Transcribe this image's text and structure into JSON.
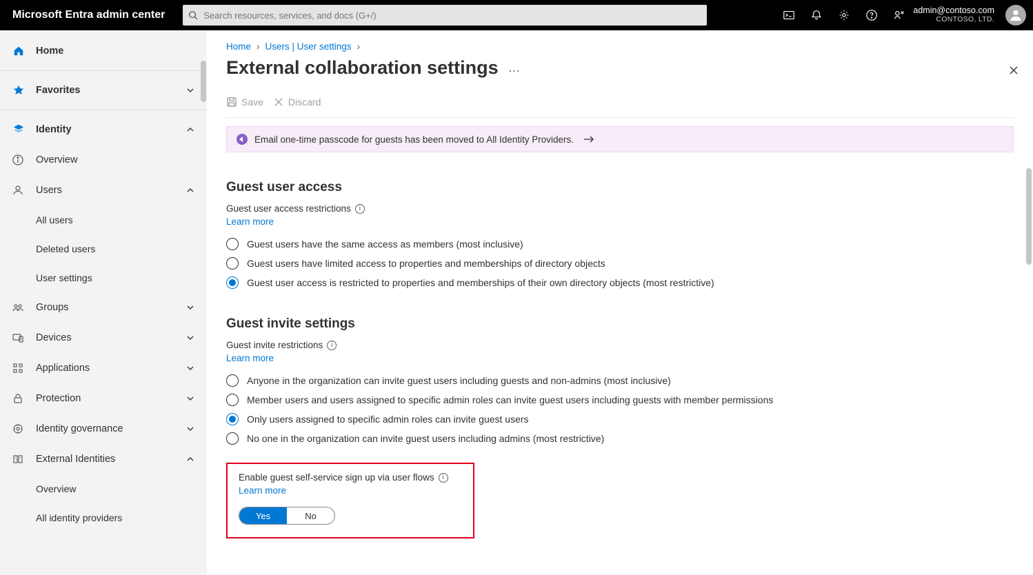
{
  "header": {
    "brand": "Microsoft Entra admin center",
    "search_placeholder": "Search resources, services, and docs (G+/)",
    "account_email": "admin@contoso.com",
    "account_org": "CONTOSO, LTD."
  },
  "sidebar": {
    "home": "Home",
    "favorites": "Favorites",
    "identity": "Identity",
    "overview": "Overview",
    "users": "Users",
    "users_children": {
      "all": "All users",
      "deleted": "Deleted users",
      "settings": "User settings"
    },
    "groups": "Groups",
    "devices": "Devices",
    "applications": "Applications",
    "protection": "Protection",
    "governance": "Identity governance",
    "external": "External Identities",
    "external_children": {
      "overview": "Overview",
      "providers": "All identity providers"
    }
  },
  "breadcrumbs": {
    "b1": "Home",
    "b2": "Users | User settings"
  },
  "page": {
    "title": "External collaboration settings",
    "save": "Save",
    "discard": "Discard"
  },
  "notice": {
    "text": "Email one-time passcode for guests has been moved to All Identity Providers."
  },
  "guest_access": {
    "heading": "Guest user access",
    "restrictions_label": "Guest user access restrictions",
    "learn_more": "Learn more",
    "opt1": "Guest users have the same access as members (most inclusive)",
    "opt2": "Guest users have limited access to properties and memberships of directory objects",
    "opt3": "Guest user access is restricted to properties and memberships of their own directory objects (most restrictive)",
    "selected": 3
  },
  "guest_invite": {
    "heading": "Guest invite settings",
    "restrictions_label": "Guest invite restrictions",
    "learn_more": "Learn more",
    "opt1": "Anyone in the organization can invite guest users including guests and non-admins (most inclusive)",
    "opt2": "Member users and users assigned to specific admin roles can invite guest users including guests with member permissions",
    "opt3": "Only users assigned to specific admin roles can invite guest users",
    "opt4": "No one in the organization can invite guest users including admins (most restrictive)",
    "selected": 3
  },
  "self_service": {
    "label": "Enable guest self-service sign up via user flows",
    "learn_more": "Learn more",
    "yes": "Yes",
    "no": "No",
    "value": true
  }
}
